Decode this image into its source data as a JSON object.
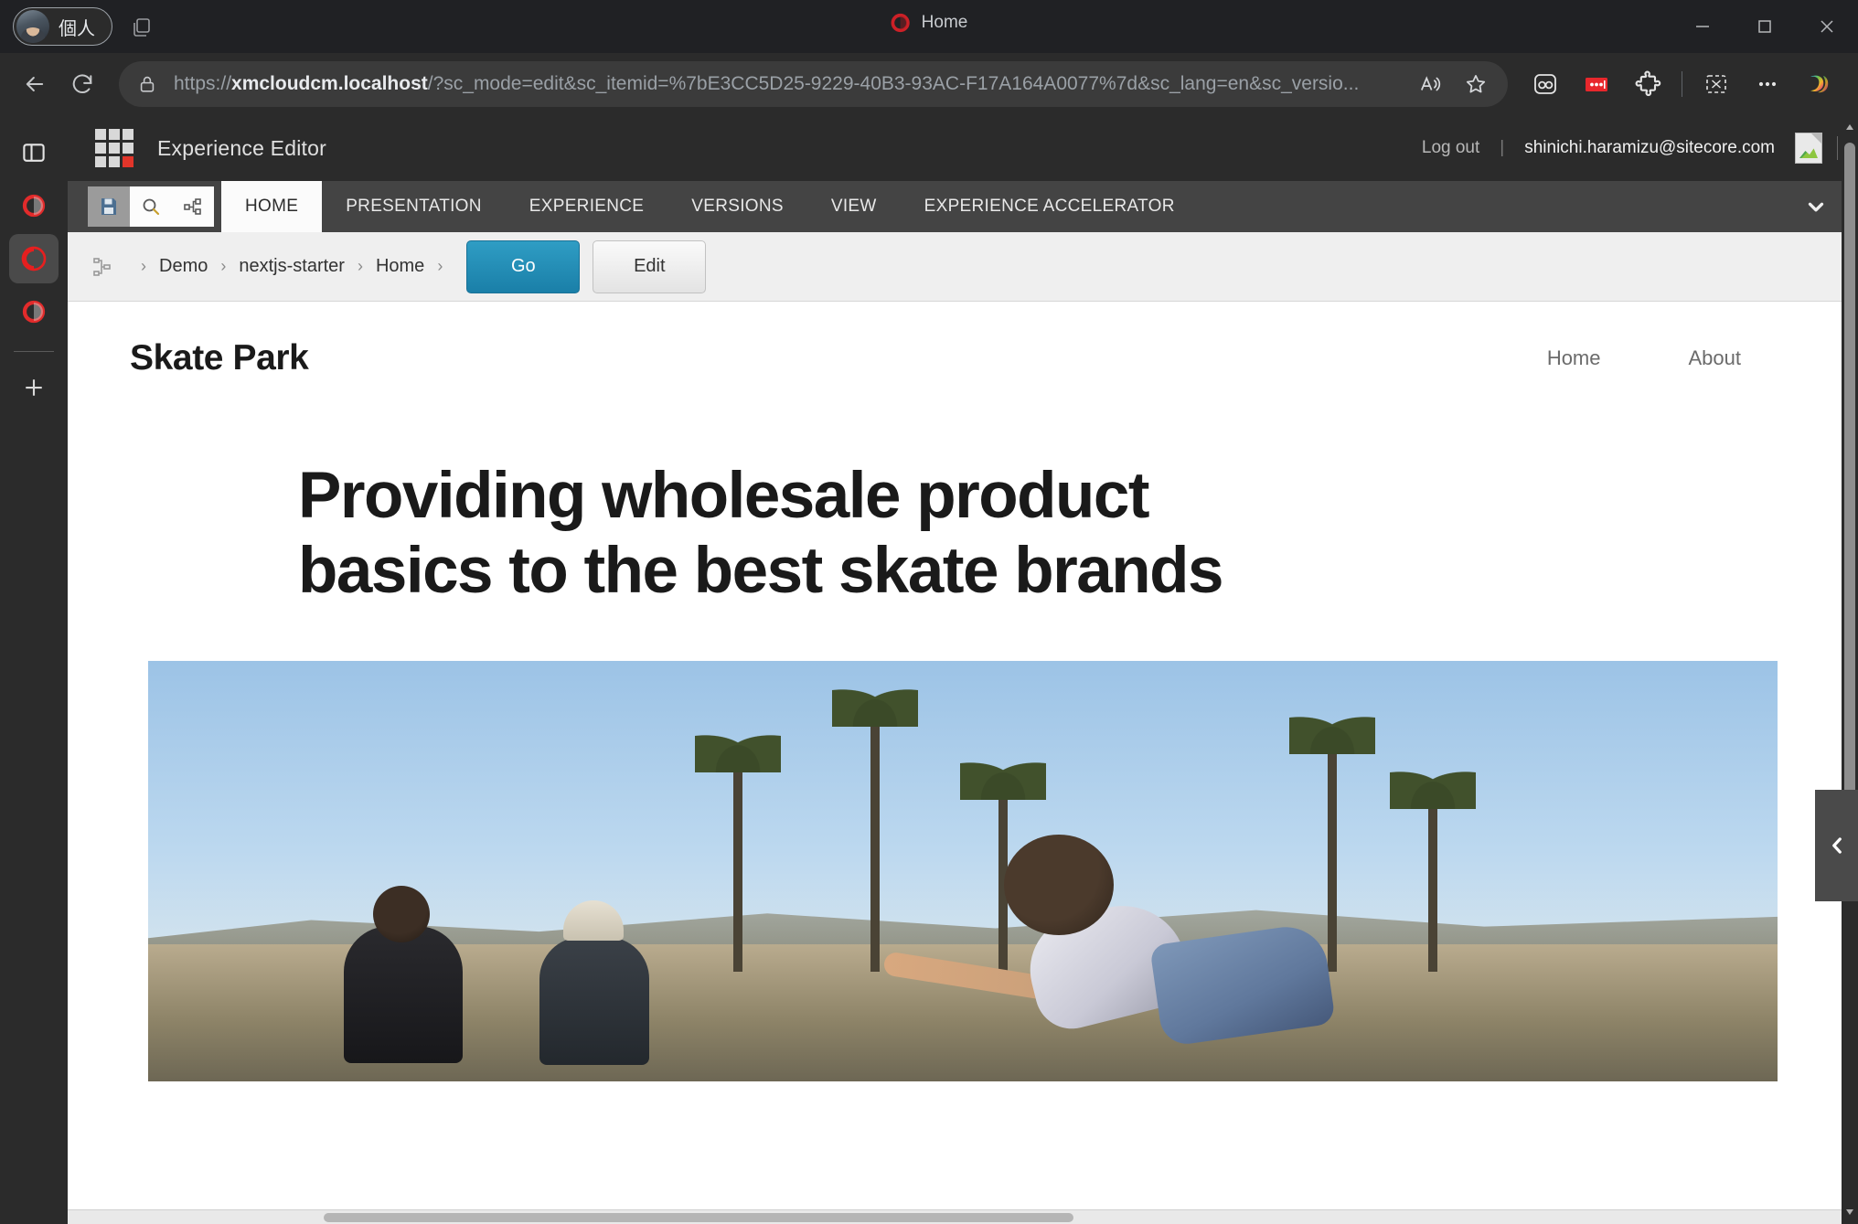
{
  "browser": {
    "profile_label": "個人",
    "tab": {
      "title": "Home",
      "favicon": "sitecore-logo-icon"
    },
    "window_controls": {
      "minimize": "–",
      "maximize": "□",
      "close": "✕"
    },
    "nav": {
      "back": "back-arrow-icon",
      "reload": "reload-icon"
    },
    "address": {
      "lock": "lock-icon",
      "scheme": "https://",
      "host": "xmcloudcm.localhost",
      "path": "/?sc_mode=edit&sc_itemid=%7bE3CC5D25-9229-40B3-93AC-F17A164A0077%7d&sc_lang=en&sc_versio...",
      "read_aloud": "read-aloud-icon",
      "favorite": "star-icon"
    },
    "extensions": [
      {
        "name": "pocket-extension-icon",
        "label": ""
      },
      {
        "name": "red-dots-extension-icon",
        "label": ""
      },
      {
        "name": "puzzle-extensions-icon",
        "label": ""
      },
      {
        "name": "screenshot-capture-icon",
        "label": ""
      },
      {
        "name": "settings-more-icon",
        "label": "…"
      },
      {
        "name": "copilot-icon",
        "label": ""
      }
    ],
    "rail": [
      {
        "name": "sidebar-toggle-icon"
      },
      {
        "name": "sitecore-app-1-icon",
        "active": false
      },
      {
        "name": "sitecore-app-2-icon",
        "active": true
      },
      {
        "name": "sitecore-app-3-icon",
        "active": false
      },
      {
        "name": "add-workspace-icon",
        "label": "+"
      }
    ]
  },
  "sitecore": {
    "app_title": "Experience Editor",
    "waffle": "app-launcher-icon",
    "logout_label": "Log out",
    "separator": "|",
    "user_email": "shinichi.haramizu@sitecore.com",
    "avatar": "broken-image-avatar",
    "quick_access": [
      {
        "name": "save-icon"
      },
      {
        "name": "search-icon"
      },
      {
        "name": "navigate-icon"
      }
    ],
    "ribbon_tabs": [
      {
        "label": "HOME",
        "active": true
      },
      {
        "label": "PRESENTATION",
        "active": false
      },
      {
        "label": "EXPERIENCE",
        "active": false
      },
      {
        "label": "VERSIONS",
        "active": false
      },
      {
        "label": "VIEW",
        "active": false
      },
      {
        "label": "EXPERIENCE ACCELERATOR",
        "active": false
      }
    ],
    "ribbon_expand": "chevron-down-icon",
    "breadcrumb": {
      "tree_icon": "content-tree-icon",
      "items": [
        "Demo",
        "nextjs-starter",
        "Home"
      ],
      "chevron": "›",
      "go_button": "Go",
      "edit_button": "Edit"
    },
    "collapse_handle": "collapse-panel-chevron-icon"
  },
  "site": {
    "logo": "Skate Park",
    "nav": [
      {
        "label": "Home"
      },
      {
        "label": "About"
      }
    ],
    "hero": {
      "title": "Providing wholesale product basics to the best skate brands",
      "image_alt": "skater-in-skate-park-photo"
    }
  },
  "colors": {
    "accent_blue": "#1a7fa8",
    "sitecore_red": "#e2352a",
    "chrome_dark": "#2b2b2b",
    "ribbon_gray": "#444444"
  }
}
